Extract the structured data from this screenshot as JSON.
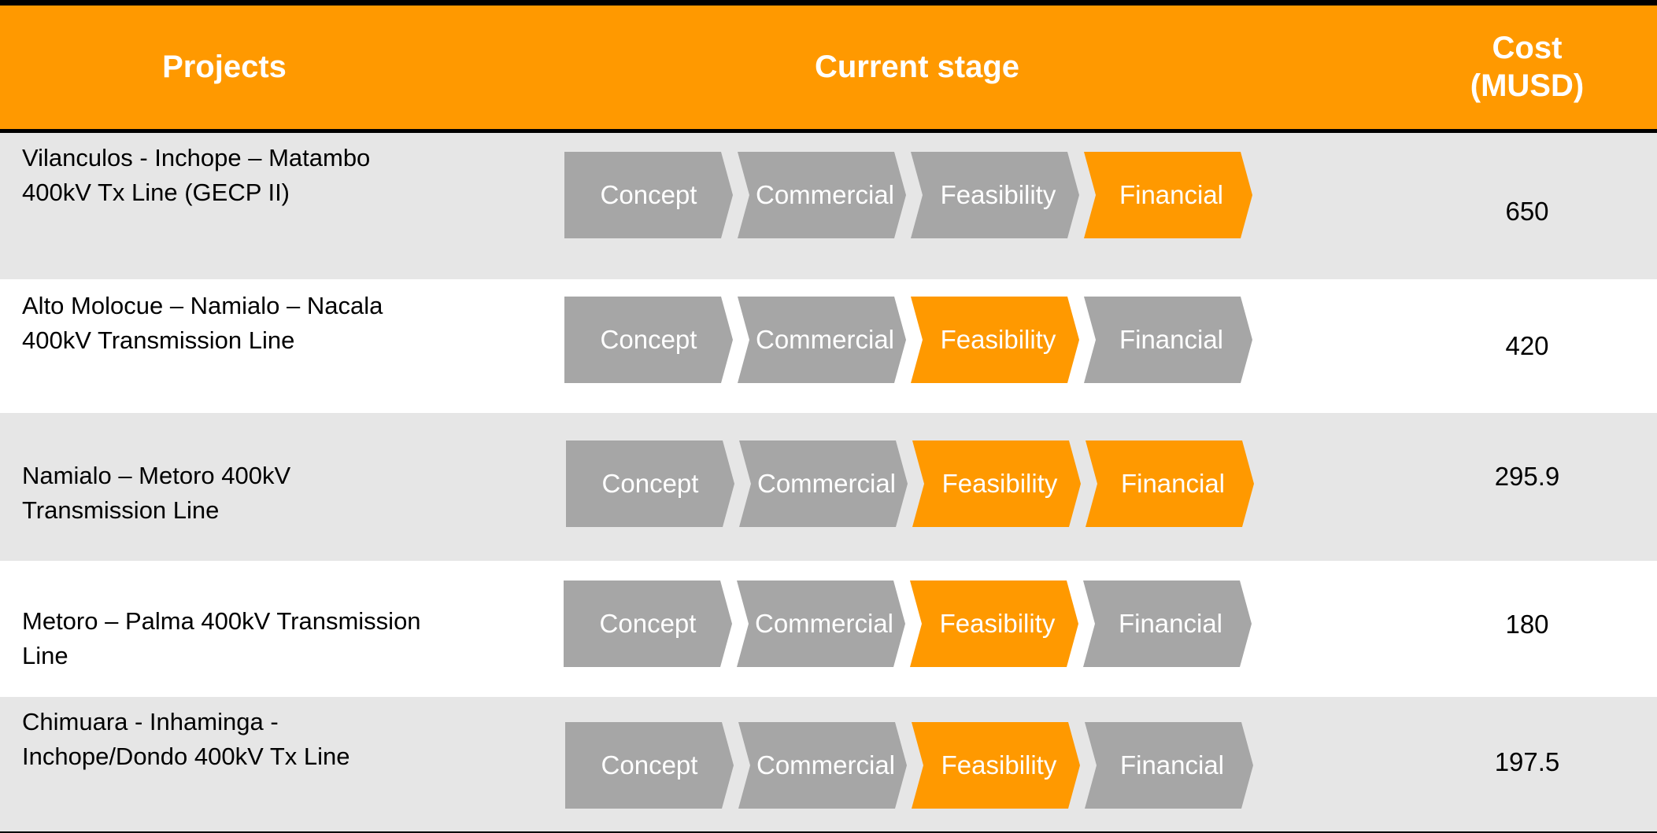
{
  "table": {
    "headers": {
      "projects": "Projects",
      "stage": "Current stage",
      "cost_line1": "Cost",
      "cost_line2": "(MUSD)"
    },
    "stage_labels": [
      "Concept",
      "Commercial",
      "Feasibility",
      "Financial"
    ],
    "colors": {
      "header_bg": "#ff9900",
      "highlight": "#ff9900",
      "inactive": "#a6a6a6",
      "row_shade": "#e6e6e6"
    },
    "rows": [
      {
        "project_line1": "Vilanculos - Inchope – Matambo",
        "project_line2": "400kV  Tx Line (GECP II)",
        "cost": "650",
        "highlighted_stages": [
          "Financial"
        ]
      },
      {
        "project_line1": "Alto Molocue – Namialo – Nacala",
        "project_line2": "400kV Transmission Line",
        "cost": "420",
        "highlighted_stages": [
          "Feasibility"
        ]
      },
      {
        "project_line1": "Namialo – Metoro 400kV",
        "project_line2": "Transmission Line",
        "cost": "295.9",
        "highlighted_stages": [
          "Feasibility",
          "Financial"
        ]
      },
      {
        "project_line1": "Metoro – Palma 400kV Transmission",
        "project_line2": "Line",
        "cost": "180",
        "highlighted_stages": [
          "Feasibility"
        ]
      },
      {
        "project_line1": "Chimuara - Inhaminga -",
        "project_line2": "Inchope/Dondo 400kV Tx Line",
        "cost": "197.5",
        "highlighted_stages": [
          "Feasibility"
        ]
      }
    ]
  }
}
